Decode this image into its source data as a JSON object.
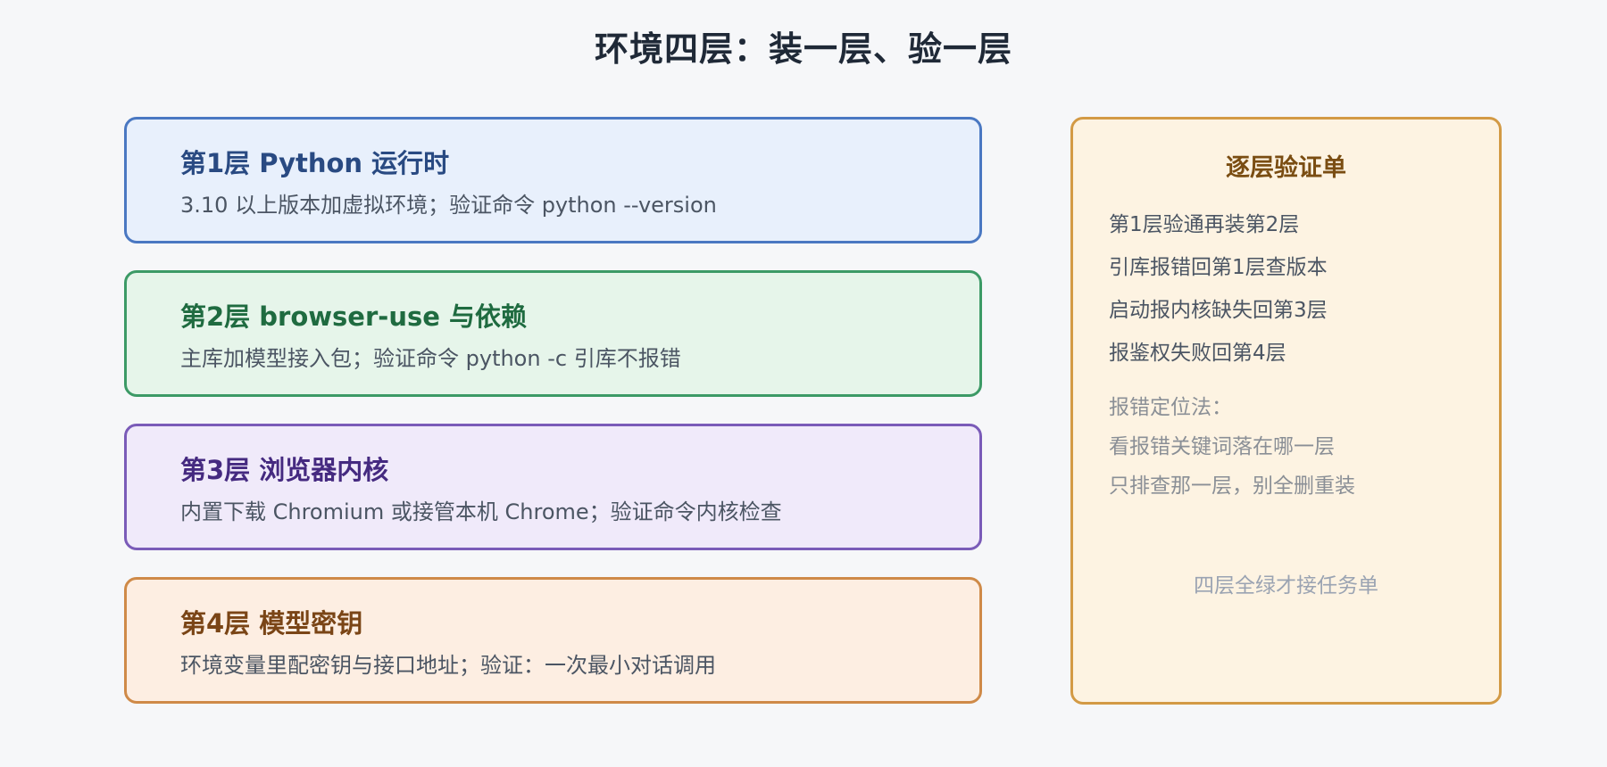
{
  "title": "环境四层：装一层、验一层",
  "layers": [
    {
      "title": "第1层 Python 运行时",
      "desc": "3.10 以上版本加虚拟环境；验证命令 python --version"
    },
    {
      "title": "第2层 browser-use 与依赖",
      "desc": "主库加模型接入包；验证命令 python -c 引库不报错"
    },
    {
      "title": "第3层 浏览器内核",
      "desc": "内置下载 Chromium 或接管本机 Chrome；验证命令内核检查"
    },
    {
      "title": "第4层 模型密钥",
      "desc": "环境变量里配密钥与接口地址；验证：一次最小对话调用"
    }
  ],
  "checklist": {
    "title": "逐层验证单",
    "items": [
      "第1层验通再装第2层",
      "引库报错回第1层查版本",
      "启动报内核缺失回第3层",
      "报鉴权失败回第4层"
    ],
    "tips": [
      "报错定位法：",
      "看报错关键词落在哪一层",
      "只排查那一层，别全删重装"
    ],
    "footer": "四层全绿才接任务单"
  },
  "colors": {
    "layer1": "#4a78c2",
    "layer2": "#3c9a66",
    "layer3": "#7a5bb8",
    "layer4": "#cf8a48",
    "checklist": "#d39a45"
  }
}
